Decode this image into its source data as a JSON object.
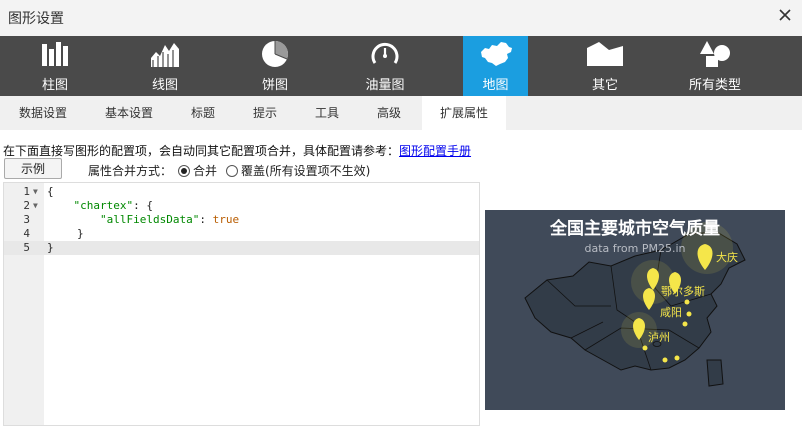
{
  "window": {
    "title": "图形设置",
    "close_icon": "close-icon"
  },
  "chart_types": [
    {
      "label": "柱图",
      "icon": "bar-chart-icon"
    },
    {
      "label": "线图",
      "icon": "line-chart-icon"
    },
    {
      "label": "饼图",
      "icon": "pie-chart-icon"
    },
    {
      "label": "油量图",
      "icon": "gauge-icon"
    },
    {
      "label": "地图",
      "icon": "map-icon",
      "active": true
    },
    {
      "label": "其它",
      "icon": "other-chart-icon"
    },
    {
      "label": "所有类型",
      "icon": "all-types-icon"
    }
  ],
  "tabs": [
    {
      "label": "数据设置"
    },
    {
      "label": "基本设置"
    },
    {
      "label": "标题"
    },
    {
      "label": "提示"
    },
    {
      "label": "工具"
    },
    {
      "label": "高级"
    },
    {
      "label": "扩展属性",
      "active": true
    }
  ],
  "info": {
    "text": "在下面直接写图形的配置项，会自动同其它配置项合并，具体配置请参考：",
    "link": "图形配置手册"
  },
  "controls": {
    "example_button": "示例",
    "merge_label": "属性合并方式：",
    "merge_option": "合并",
    "override_option": "覆盖(所有设置项不生效)",
    "selected": "merge"
  },
  "editor": {
    "lines": [
      {
        "num": "1",
        "text": "{",
        "fold": true
      },
      {
        "num": "2",
        "text_key": "\"chartex\"",
        "text_rest": ": {",
        "fold": true
      },
      {
        "num": "3",
        "text_key": "\"allFieldsData\"",
        "text_rest": ": ",
        "text_bool": "true"
      },
      {
        "num": "4",
        "text": "}"
      },
      {
        "num": "5",
        "text": "}",
        "current": true
      }
    ]
  },
  "preview": {
    "title": "全国主要城市空气质量",
    "subtitle": "data from PM25.in",
    "cities": [
      "大庆",
      "鄂尔多斯",
      "咸阳",
      "泸州"
    ],
    "colors": {
      "background": "#404a59",
      "land": "#323c48",
      "border": "#111111",
      "marker": "#f5e64a"
    }
  },
  "colors": {
    "accent": "#1b9ee0",
    "typebar": "#4a4a4a"
  }
}
